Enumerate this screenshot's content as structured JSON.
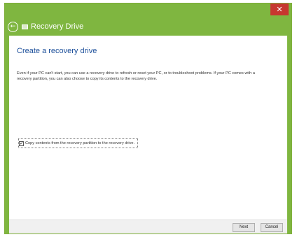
{
  "window": {
    "title": "Recovery Drive",
    "close_glyph": "✕",
    "back_glyph": "←",
    "accent_color": "#7fb640",
    "close_color": "#c7372f"
  },
  "main": {
    "heading": "Create a recovery drive",
    "description": "Even if your PC can't start, you can use a recovery drive to refresh or reset your PC, or to troubleshoot problems. If your PC comes with a recovery partition, you can also choose to copy its contents to the recovery drive.",
    "option": {
      "checked": true,
      "check_glyph": "✓",
      "label": "Copy contents from the recovery partition to the recovery drive."
    }
  },
  "footer": {
    "next_label": "Next",
    "cancel_label": "Cancel"
  }
}
